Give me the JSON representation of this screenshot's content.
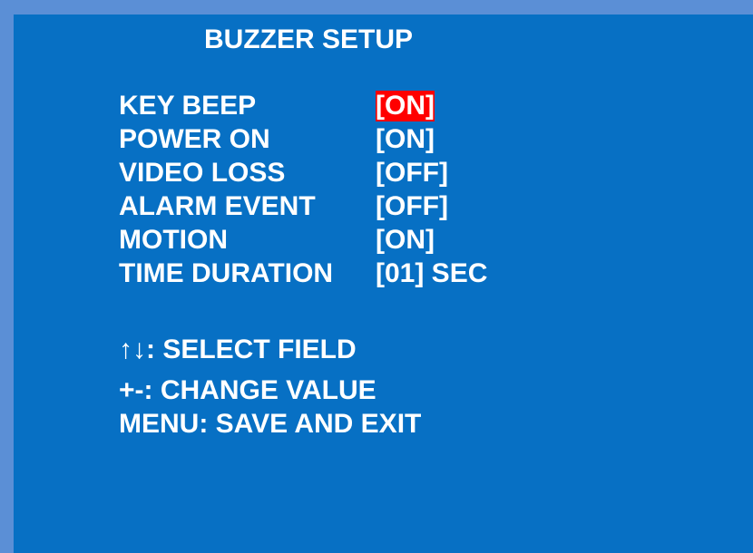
{
  "screen": {
    "title": "BUZZER SETUP",
    "items": [
      {
        "label": "KEY BEEP",
        "value": "[ON]",
        "selected": true
      },
      {
        "label": "POWER ON",
        "value": "[ON]",
        "selected": false
      },
      {
        "label": "VIDEO LOSS",
        "value": "[OFF]",
        "selected": false
      },
      {
        "label": "ALARM EVENT",
        "value": "[OFF]",
        "selected": false
      },
      {
        "label": "MOTION",
        "value": "[ON]",
        "selected": false
      },
      {
        "label": "TIME DURATION",
        "value": "[01] SEC",
        "selected": false
      }
    ],
    "help": {
      "select_field": "↑↓: SELECT FIELD",
      "change_value": "+-: CHANGE VALUE",
      "save_exit": "MENU: SAVE AND EXIT"
    }
  },
  "colors": {
    "background": "#0770c4",
    "border": "#5b8fd6",
    "highlight": "#ff0000",
    "text": "#ffffff"
  }
}
